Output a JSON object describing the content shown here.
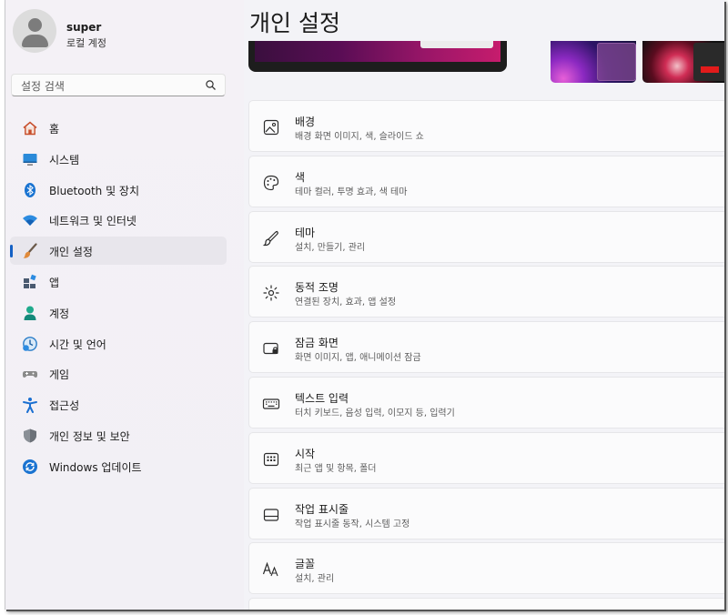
{
  "user": {
    "name": "super",
    "account_type": "로컬 계정"
  },
  "search": {
    "placeholder": "설정 검색"
  },
  "nav": [
    {
      "label": "홈",
      "icon": "home-icon"
    },
    {
      "label": "시스템",
      "icon": "monitor-icon"
    },
    {
      "label": "Bluetooth 및 장치",
      "icon": "bluetooth-icon"
    },
    {
      "label": "네트워크 및 인터넷",
      "icon": "wifi-icon"
    },
    {
      "label": "개인 설정",
      "icon": "paintbrush-icon",
      "active": true
    },
    {
      "label": "앱",
      "icon": "apps-icon"
    },
    {
      "label": "계정",
      "icon": "account-icon"
    },
    {
      "label": "시간 및 언어",
      "icon": "clock-globe-icon"
    },
    {
      "label": "게임",
      "icon": "gamepad-icon"
    },
    {
      "label": "접근성",
      "icon": "accessibility-icon"
    },
    {
      "label": "개인 정보 및 보안",
      "icon": "shield-icon"
    },
    {
      "label": "Windows 업데이트",
      "icon": "update-icon"
    }
  ],
  "page": {
    "title": "개인 설정"
  },
  "cards": [
    {
      "title": "배경",
      "subtitle": "배경 화면 이미지, 색, 슬라이드 쇼",
      "icon": "image-icon"
    },
    {
      "title": "색",
      "subtitle": "테마 컬러, 투명 효과, 색 테마",
      "icon": "palette-icon"
    },
    {
      "title": "테마",
      "subtitle": "설치, 만들기, 관리",
      "icon": "brush-icon"
    },
    {
      "title": "동적 조명",
      "subtitle": "연결된 장치, 효과, 앱 설정",
      "icon": "dynamic-lighting-icon"
    },
    {
      "title": "잠금 화면",
      "subtitle": "화면 이미지, 앱, 애니메이션 잠금",
      "icon": "lock-screen-icon"
    },
    {
      "title": "텍스트 입력",
      "subtitle": "터치 키보드, 음성 입력, 이모지 등, 입력기",
      "icon": "keyboard-icon"
    },
    {
      "title": "시작",
      "subtitle": "최근 앱 및 항목, 폴더",
      "icon": "start-icon"
    },
    {
      "title": "작업 표시줄",
      "subtitle": "작업 표시줄 동작, 시스템 고정",
      "icon": "taskbar-icon"
    },
    {
      "title": "글꼴",
      "subtitle": "설치, 관리",
      "icon": "font-icon"
    }
  ],
  "colors": {
    "accent": "#1460c4",
    "window_bg": "#f3f3f7",
    "card_bg": "#fbfbfc"
  }
}
